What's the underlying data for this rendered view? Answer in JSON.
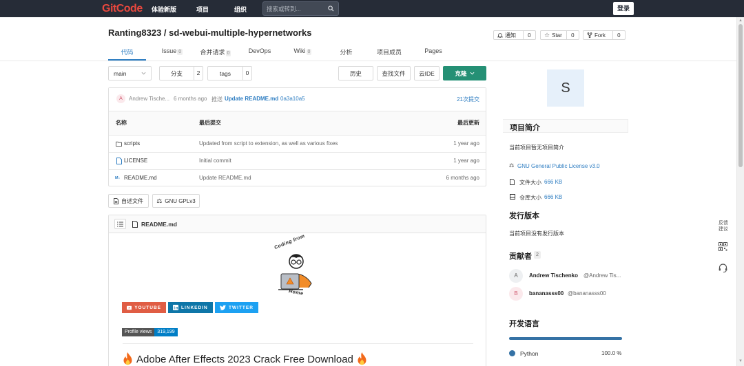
{
  "topbar": {
    "logo": "GitCode",
    "nav": [
      "体验新版",
      "项目",
      "组织"
    ],
    "search_placeholder": "搜索或转到...",
    "login": "登录"
  },
  "repo": {
    "title": "Ranting8323 / sd-webui-multiple-hypernetworks",
    "notify_label": "通知",
    "notify_count": "0",
    "star_label": "Star",
    "star_count": "0",
    "fork_label": "Fork",
    "fork_count": "0"
  },
  "tabs": [
    {
      "label": "代码",
      "badge": ""
    },
    {
      "label": "Issue",
      "badge": "0"
    },
    {
      "label": "合并请求",
      "badge": "0"
    },
    {
      "label": "DevOps",
      "badge": ""
    },
    {
      "label": "Wiki",
      "badge": "0"
    },
    {
      "label": "分析",
      "badge": ""
    },
    {
      "label": "项目成员",
      "badge": ""
    },
    {
      "label": "Pages",
      "badge": ""
    }
  ],
  "toolbar": {
    "branch": "main",
    "branches_label": "分支",
    "branches_count": "2",
    "tags_label": "tags",
    "tags_count": "0",
    "history": "历史",
    "find_file": "查找文件",
    "web_ide": "云IDE",
    "clone": "克隆"
  },
  "last_commit": {
    "avatar": "A",
    "author": "Andrew Tische...",
    "time": "6 months ago",
    "action": "推送",
    "message": "Update README.md",
    "hash": "0a3a10a5",
    "total": "21次提交"
  },
  "files": {
    "headers": [
      "名称",
      "最后提交",
      "最后更新"
    ],
    "rows": [
      {
        "icon": "folder-icon",
        "name": "scripts",
        "commit": "Updated from script to extension, as well as various fixes",
        "updated": "1 year ago"
      },
      {
        "icon": "file-icon",
        "name": "LICENSE",
        "commit": "Initial commit",
        "updated": "1 year ago"
      },
      {
        "icon": "markdown-icon",
        "name": "README.md",
        "commit": "Update README.md",
        "updated": "6 months ago"
      }
    ]
  },
  "file_tags": [
    "自述文件",
    "GNU GPLv3"
  ],
  "readme": {
    "filename": "README.md",
    "logo_top": "Coding from",
    "logo_bottom": "Home",
    "shields": [
      "YOUTUBE",
      "LINKEDIN",
      "TWITTER"
    ],
    "views_label": "Profile views",
    "views_count": "319,199",
    "heading": "Adobe After Effects 2023 Crack Free Download"
  },
  "sidebar": {
    "avatar_letter": "S",
    "intro_title": "项目简介",
    "intro_text": "当前项目暂无项目简介",
    "license": "GNU General Public License v3.0",
    "file_size_label": "文件大小",
    "file_size": "666 KB",
    "repo_size_label": "仓库大小",
    "repo_size": "666 KB",
    "release_title": "发行版本",
    "release_text": "当前项目没有发行版本",
    "contributors_title": "贡献者",
    "contributors_count": "2",
    "contributors": [
      {
        "avatar": "A",
        "name": "Andrew Tischenko",
        "handle": "@Andrew Tis..."
      },
      {
        "avatar": "B",
        "name": "bananasss00",
        "handle": "@bananasss00"
      }
    ],
    "lang_title": "开发语言",
    "lang_name": "Python",
    "lang_percent": "100.0 %",
    "lang_fraction": 1.0
  },
  "float": {
    "feedback": [
      "反馈",
      "建议"
    ]
  },
  "colors": {
    "topbar": "#262c37",
    "brand": "#e9483e",
    "link": "#2f7ec2",
    "clone": "#259075",
    "youtube": "#e05d44",
    "linkedin": "#0e76a8",
    "twitter": "#1da1f2",
    "python": "#3572a5"
  }
}
